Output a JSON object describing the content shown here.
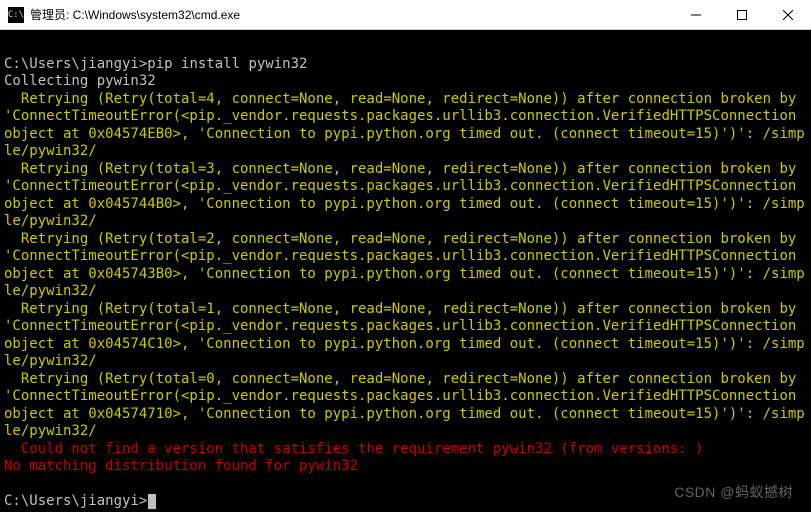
{
  "window": {
    "title": "管理员: C:\\Windows\\system32\\cmd.exe",
    "icon_label": "cmd-icon"
  },
  "terminal": {
    "prompt1_path": "C:\\Users\\jiangyi>",
    "prompt1_cmd": "pip install pywin32",
    "collecting": "Collecting pywin32",
    "retry1": "  Retrying (Retry(total=4, connect=None, read=None, redirect=None)) after connection broken by 'ConnectTimeoutError(<pip._vendor.requests.packages.urllib3.connection.VerifiedHTTPSConnection object at 0x04574EB0>, 'Connection to pypi.python.org timed out. (connect timeout=15)')': /simple/pywin32/",
    "retry2": "  Retrying (Retry(total=3, connect=None, read=None, redirect=None)) after connection broken by 'ConnectTimeoutError(<pip._vendor.requests.packages.urllib3.connection.VerifiedHTTPSConnection object at 0x045744B0>, 'Connection to pypi.python.org timed out. (connect timeout=15)')': /simple/pywin32/",
    "retry3": "  Retrying (Retry(total=2, connect=None, read=None, redirect=None)) after connection broken by 'ConnectTimeoutError(<pip._vendor.requests.packages.urllib3.connection.VerifiedHTTPSConnection object at 0x045743B0>, 'Connection to pypi.python.org timed out. (connect timeout=15)')': /simple/pywin32/",
    "retry4": "  Retrying (Retry(total=1, connect=None, read=None, redirect=None)) after connection broken by 'ConnectTimeoutError(<pip._vendor.requests.packages.urllib3.connection.VerifiedHTTPSConnection object at 0x04574C10>, 'Connection to pypi.python.org timed out. (connect timeout=15)')': /simple/pywin32/",
    "retry5": "  Retrying (Retry(total=0, connect=None, read=None, redirect=None)) after connection broken by 'ConnectTimeoutError(<pip._vendor.requests.packages.urllib3.connection.VerifiedHTTPSConnection object at 0x04574710>, 'Connection to pypi.python.org timed out. (connect timeout=15)')': /simple/pywin32/",
    "error1": "  Could not find a version that satisfies the requirement pywin32 (from versions: )",
    "error2": "No matching distribution found for pywin32",
    "prompt2": "C:\\Users\\jiangyi>"
  },
  "watermark": "CSDN @蚂蚁撼树"
}
